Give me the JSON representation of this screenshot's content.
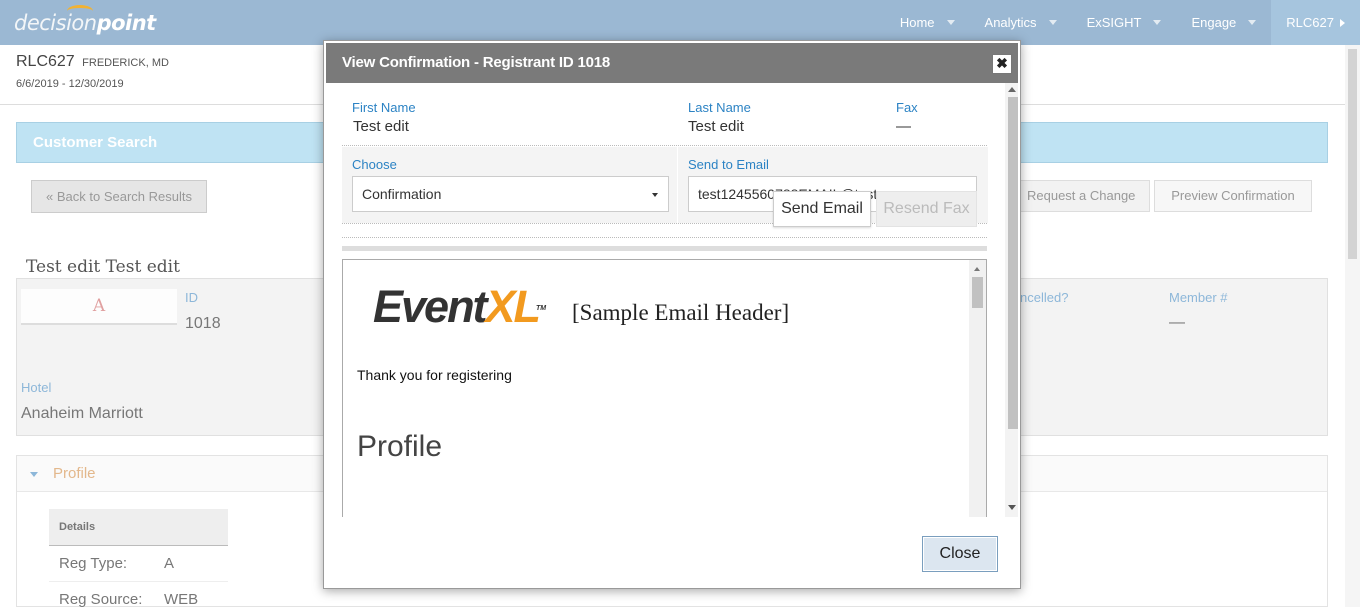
{
  "brand": {
    "logo_part1": "decision",
    "logo_part2": "point"
  },
  "nav": {
    "items": [
      {
        "label": "Home"
      },
      {
        "label": "Analytics"
      },
      {
        "label": "ExSIGHT"
      },
      {
        "label": "Engage"
      },
      {
        "label": "RLC627"
      }
    ]
  },
  "event": {
    "code": "RLC627",
    "city": "FREDERICK, MD",
    "dates": "6/6/2019 - 12/30/2019"
  },
  "customer_search": {
    "title": "Customer Search"
  },
  "buttons": {
    "back": "« Back to Search Results",
    "request_change": "Request a Change",
    "preview_confirmation": "Preview Confirmation"
  },
  "registrant": {
    "name": "Test edit Test edit",
    "avatar_letter": "A",
    "id_label": "ID",
    "id_value": "1018",
    "cancelled_label": "ncelled?",
    "member_label": "Member #",
    "member_value": "—",
    "hotel_label": "Hotel",
    "hotel_value": "Anaheim Marriott"
  },
  "profile_section": {
    "title": "Profile",
    "details_header": "Details",
    "rows": [
      {
        "key": "Reg Type:",
        "value": "A"
      },
      {
        "key": "Reg Source:",
        "value": "WEB"
      }
    ]
  },
  "modal": {
    "title": "View Confirmation - Registrant ID 1018",
    "close_x": "✖",
    "first_name_label": "First Name",
    "first_name_value": "Test edit",
    "last_name_label": "Last Name",
    "last_name_value": "Test edit",
    "fax_label": "Fax",
    "fax_value": "—",
    "choose_label": "Choose",
    "choose_value": "Confirmation",
    "send_to_email_label": "Send to Email",
    "send_to_email_value": "test1245560788EMAIL@test.com",
    "send_email_button": "Send Email",
    "resend_fax_button": "Resend Fax",
    "close_button": "Close",
    "email_preview": {
      "logo_event": "Event",
      "logo_xl": "XL",
      "logo_tm": "TM",
      "header_text": "[Sample Email Header]",
      "thanks_text": "Thank you for registering",
      "profile_heading": "Profile"
    }
  }
}
